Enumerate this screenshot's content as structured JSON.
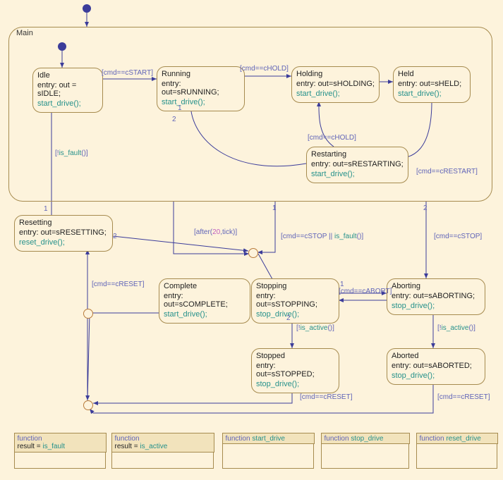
{
  "main": {
    "title": "Main"
  },
  "states": {
    "idle": {
      "name": "Idle",
      "entry": "entry: out = sIDLE;",
      "call": "start_drive();"
    },
    "running": {
      "name": "Running",
      "entry": "entry: out=sRUNNING;",
      "call": "start_drive();"
    },
    "holding": {
      "name": "Holding",
      "entry": "entry: out=sHOLDING;",
      "call": "start_drive();"
    },
    "held": {
      "name": "Held",
      "entry": "entry: out=sHELD;",
      "call": "start_drive();"
    },
    "restarting": {
      "name": "Restarting",
      "entry": "entry: out=sRESTARTING;",
      "call": "start_drive();"
    },
    "resetting": {
      "name": "Resetting",
      "entry": "entry: out=sRESETTING;",
      "call": "reset_drive();"
    },
    "complete": {
      "name": "Complete",
      "entry": "entry: out=sCOMPLETE;",
      "call": "start_drive();"
    },
    "stopping": {
      "name": "Stopping",
      "entry": "entry: out=sSTOPPING;",
      "call": "stop_drive();"
    },
    "aborting": {
      "name": "Aborting",
      "entry": "entry: out=sABORTING;",
      "call": "stop_drive();"
    },
    "stopped": {
      "name": "Stopped",
      "entry": "entry: out=sSTOPPED;",
      "call": "stop_drive();"
    },
    "aborted": {
      "name": "Aborted",
      "entry": "entry: out=sABORTED;",
      "call": "stop_drive();"
    }
  },
  "labels": {
    "trans_idle_running": "[cmd==cSTART]",
    "trans_running_holding": "[cmd==cHOLD]",
    "trans_restarting_holding": "[cmd==cHOLD]",
    "trans_held_restarting": "[cmd==cRESTART]",
    "trans_resetting_idle_pre": "[!",
    "trans_resetting_idle_fn": "is_fault",
    "trans_resetting_idle_post": "()]",
    "after_pre": "[after(",
    "after_num": "20",
    "after_mid": ",tick)]",
    "main_stop_pre": "[cmd==cSTOP || ",
    "main_stop_fn": "is_fault",
    "main_stop_post": "()]",
    "main_abort": "[cmd==cSTOP]",
    "stopping_aborting": "[cmd==cABORT]",
    "stop_active_pre": "[!",
    "stop_active_fn": "is_active",
    "stop_active_post": "()]",
    "abort_active_pre": "[!",
    "abort_active_fn": "is_active",
    "abort_active_post": "()]",
    "reset1": "[cmd==cRESET]",
    "reset2": "[cmd==cRESET]",
    "reset3": "[cmd==cRESET]"
  },
  "priorities": {
    "main_j1": "1",
    "main_j2": "2",
    "running_j1": "1",
    "running_j2": "2",
    "reset_j1": "1",
    "reset_j2": "2",
    "stopping_j1": "1",
    "stopping_j2": "2"
  },
  "functions": {
    "f1_kw": "function",
    "f1_body_pre": "result = ",
    "f1_body_fn": "is_fault",
    "f2_kw": "function",
    "f2_body_pre": "result = ",
    "f2_body_fn": "is_active",
    "f3_kw": "function",
    "f3_name": "start_drive",
    "f4_kw": "function",
    "f4_name": "stop_drive",
    "f5_kw": "function",
    "f5_name": "reset_drive"
  }
}
